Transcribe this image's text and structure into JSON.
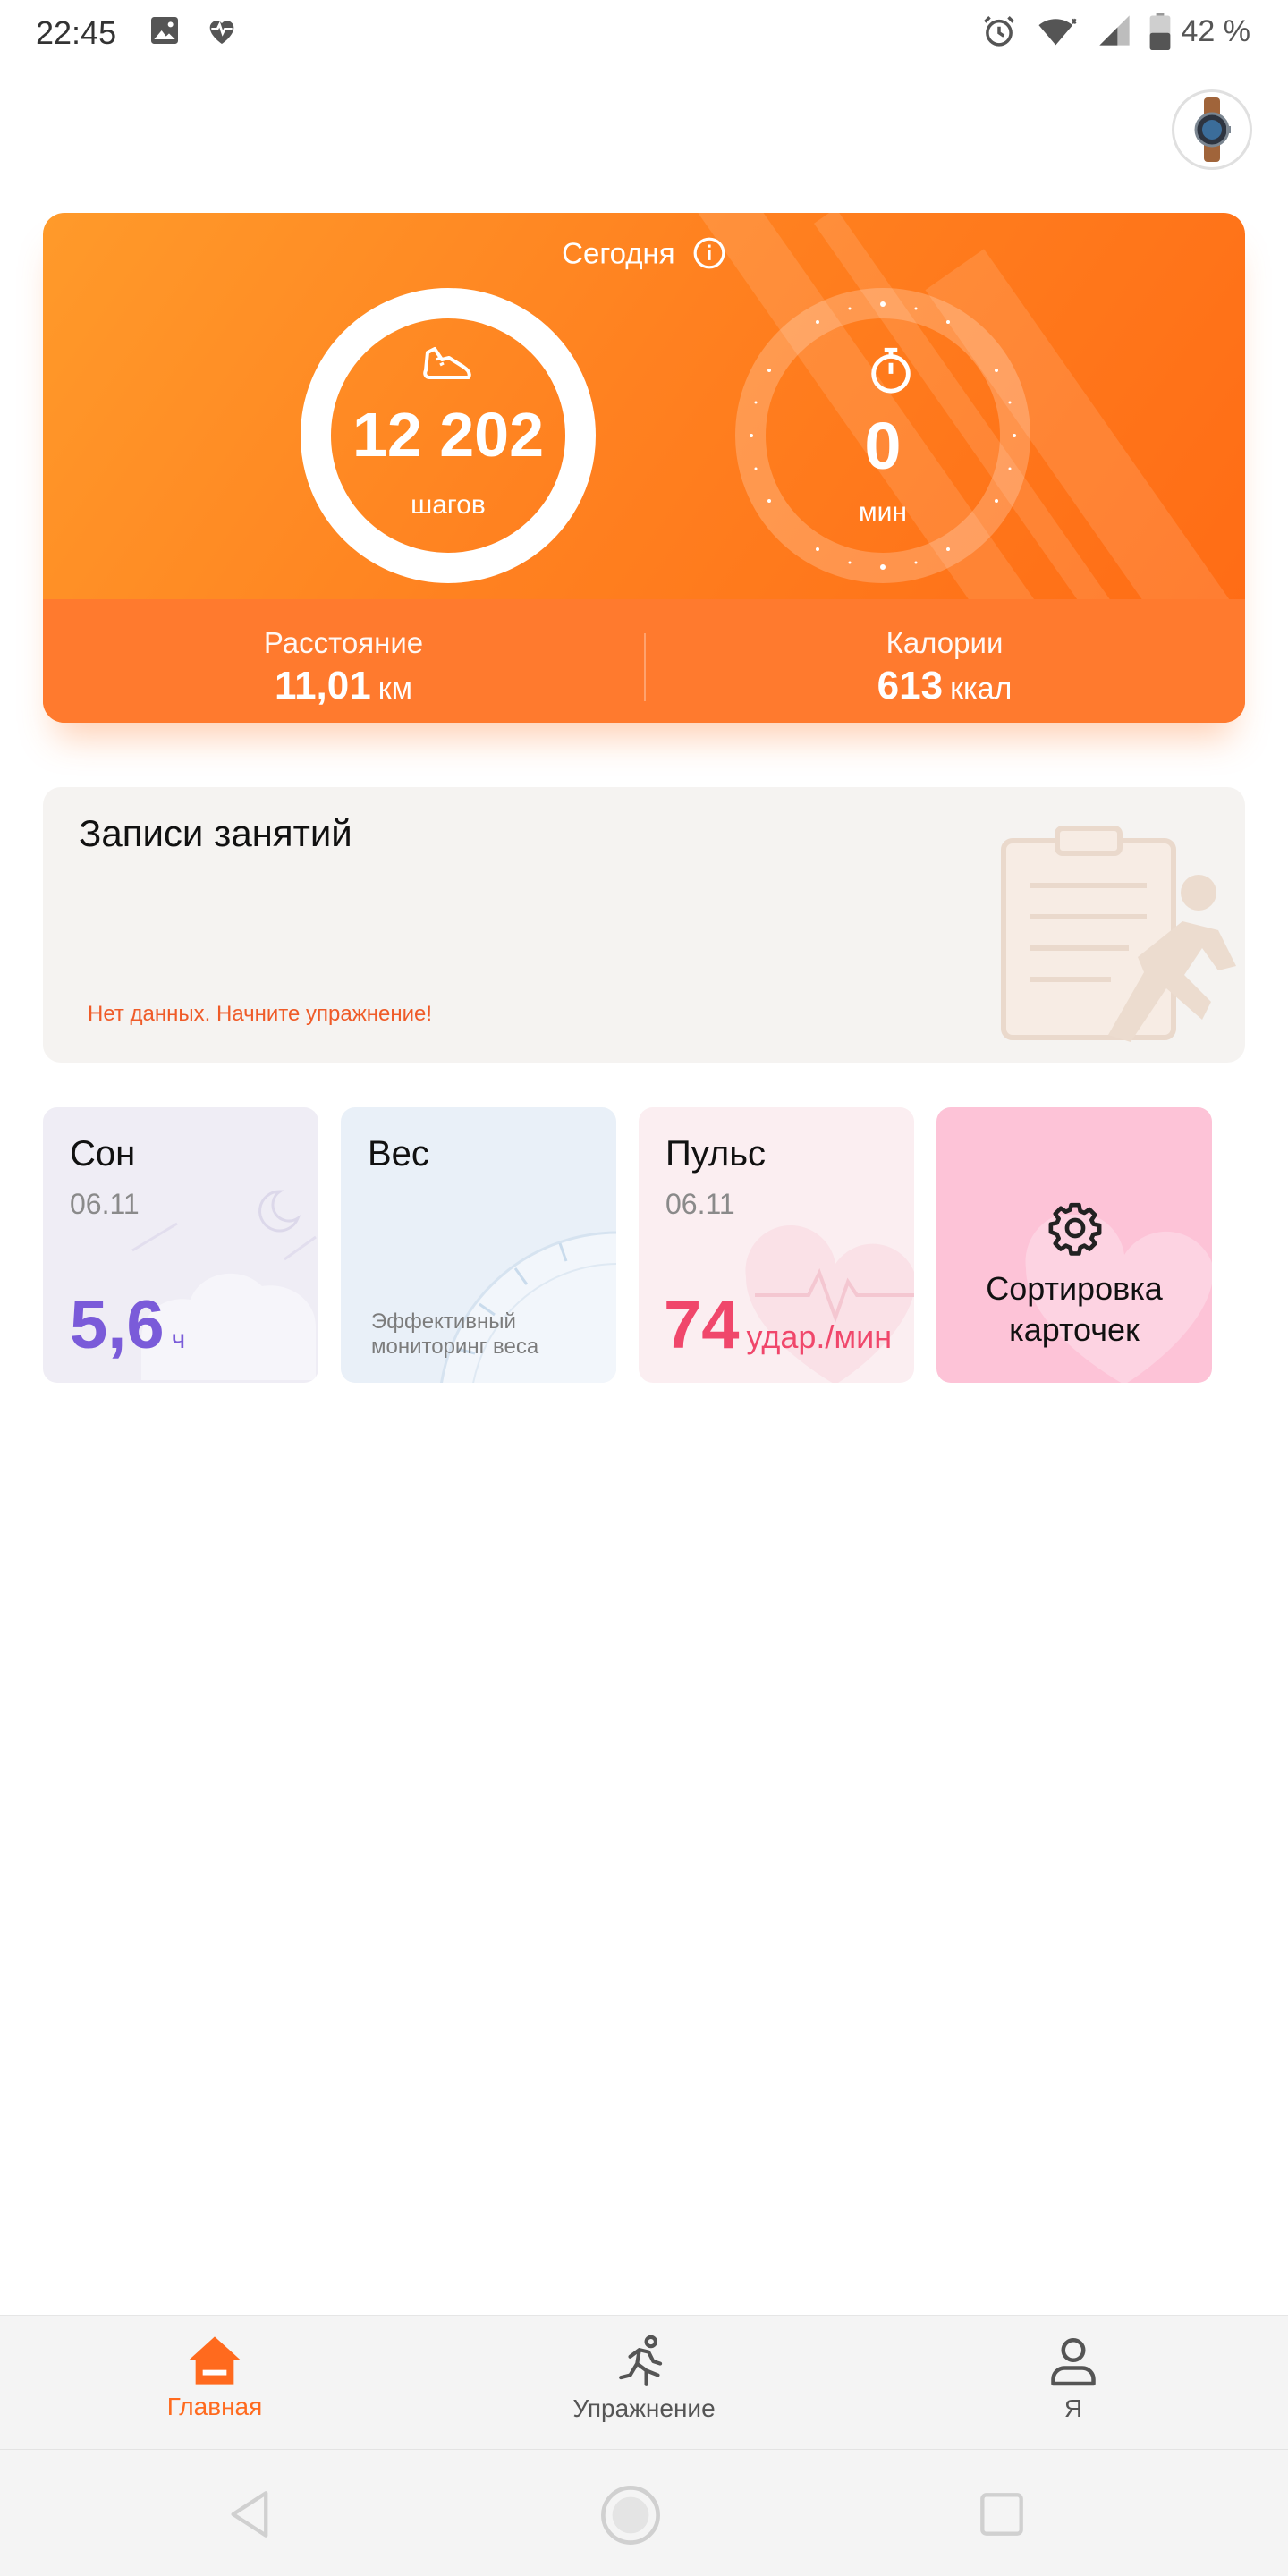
{
  "status_bar": {
    "time": "22:45",
    "battery": "42 %",
    "left_icons": [
      "image-icon",
      "heart-pulse-icon"
    ],
    "right_icons": [
      "alarm-icon",
      "wifi-icon",
      "signal-icon",
      "battery-icon"
    ]
  },
  "today": {
    "title": "Сегодня",
    "steps_value": "12 202",
    "steps_unit": "шагов",
    "active_minutes_value": "0",
    "active_minutes_unit": "мин",
    "distance_label": "Расстояние",
    "distance_value": "11,01",
    "distance_unit": "км",
    "calories_label": "Калории",
    "calories_value": "613",
    "calories_unit": "ккал",
    "accent_color": "#ff7a22"
  },
  "records": {
    "title": "Записи занятий",
    "empty_text": "Нет данных. Начните упражнение!"
  },
  "tiles": {
    "sleep": {
      "title": "Сон",
      "date": "06.11",
      "value": "5,6",
      "unit": "ч",
      "color": "#7a5bd9"
    },
    "weight": {
      "title": "Вес",
      "description": "Эффективный мониторинг веса"
    },
    "pulse": {
      "title": "Пульс",
      "date": "06.11",
      "value": "74",
      "unit": "удар./мин",
      "color": "#f0476b"
    },
    "sort": {
      "label_line1": "Сортировка",
      "label_line2": "карточек"
    }
  },
  "bottom_nav": {
    "items": [
      {
        "label": "Главная",
        "icon": "home-icon",
        "active": true
      },
      {
        "label": "Упражнение",
        "icon": "running-icon",
        "active": false
      },
      {
        "label": "Я",
        "icon": "profile-icon",
        "active": false
      }
    ]
  },
  "system_nav": [
    "back-icon",
    "home-circle-icon",
    "recents-icon"
  ]
}
